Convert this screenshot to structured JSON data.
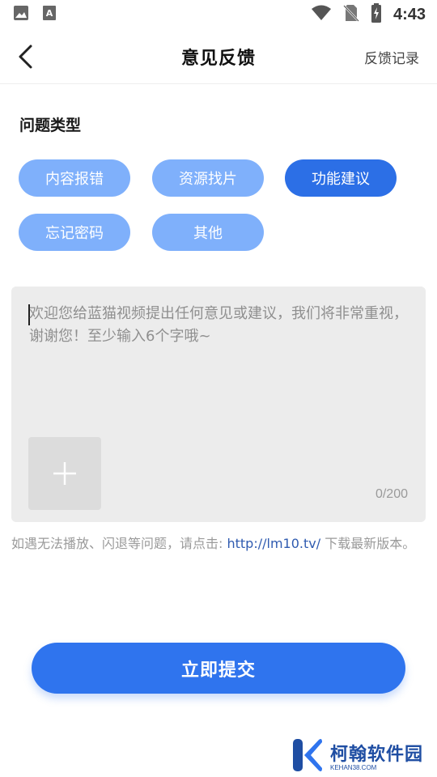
{
  "status_bar": {
    "time": "4:43",
    "icons": [
      "image-icon",
      "text-a-icon",
      "wifi-icon",
      "no-sim-icon",
      "battery-charging-icon"
    ]
  },
  "nav": {
    "title": "意见反馈",
    "history_label": "反馈记录",
    "back_icon": "chevron-left-icon"
  },
  "section": {
    "title": "问题类型"
  },
  "chips": [
    {
      "label": "内容报错",
      "selected": false
    },
    {
      "label": "资源找片",
      "selected": false
    },
    {
      "label": "功能建议",
      "selected": true
    },
    {
      "label": "忘记密码",
      "selected": false
    },
    {
      "label": "其他",
      "selected": false
    }
  ],
  "feedback": {
    "placeholder": "欢迎您给蓝猫视频提出任何意见或建议，我们将非常重视，谢谢您！至少输入6个字哦~",
    "value": "",
    "counter": "0/200",
    "add_image_icon": "plus-icon"
  },
  "notice": {
    "text_before": "如遇无法播放、闪退等问题，请点击: ",
    "link": "http://lm10.tv/",
    "text_after": " 下载最新版本。"
  },
  "submit_label": "立即提交",
  "watermark": {
    "main": "柯翰软件园",
    "sub": "KEHAN38.COM"
  },
  "colors": {
    "accent": "#2f74ee",
    "chip_inactive": "#7fb0fb",
    "chip_active": "#2c6fe6",
    "link": "#2f5bb0"
  }
}
